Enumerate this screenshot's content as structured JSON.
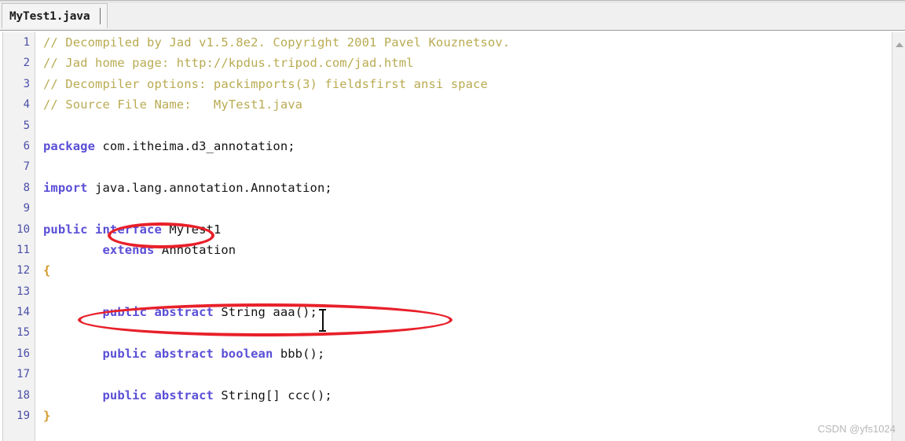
{
  "window": {
    "tab_label": "MyTest1.java"
  },
  "editor": {
    "line_numbers": [
      "1",
      "2",
      "3",
      "4",
      "5",
      "6",
      "7",
      "8",
      "9",
      "10",
      "11",
      "12",
      "13",
      "14",
      "15",
      "16",
      "17",
      "18",
      "19"
    ],
    "lines": [
      {
        "number": "1",
        "tokens": [
          {
            "t": "// Decompiled by Jad v1.5.8e2. Copyright 2001 Pavel Kouznetsov.",
            "c": "comment"
          }
        ]
      },
      {
        "number": "2",
        "tokens": [
          {
            "t": "// Jad home page: http://kpdus.tripod.com/jad.html",
            "c": "comment"
          }
        ]
      },
      {
        "number": "3",
        "tokens": [
          {
            "t": "// Decompiler options: packimports(3) fieldsfirst ansi space",
            "c": "comment"
          }
        ]
      },
      {
        "number": "4",
        "tokens": [
          {
            "t": "// Source File Name:   MyTest1.java",
            "c": "comment"
          }
        ]
      },
      {
        "number": "5",
        "tokens": []
      },
      {
        "number": "6",
        "tokens": [
          {
            "t": "package",
            "c": "keyword"
          },
          {
            "t": " com.itheima.d3_annotation;",
            "c": "plain"
          }
        ]
      },
      {
        "number": "7",
        "tokens": []
      },
      {
        "number": "8",
        "tokens": [
          {
            "t": "import",
            "c": "keyword"
          },
          {
            "t": " java.lang.annotation.Annotation;",
            "c": "plain"
          }
        ]
      },
      {
        "number": "9",
        "tokens": []
      },
      {
        "number": "10",
        "tokens": [
          {
            "t": "public interface",
            "c": "keyword"
          },
          {
            "t": " MyTest1",
            "c": "plain"
          }
        ]
      },
      {
        "number": "11",
        "tokens": [
          {
            "t": "        extends",
            "c": "keyword"
          },
          {
            "t": " Annotation",
            "c": "plain"
          }
        ]
      },
      {
        "number": "12",
        "tokens": [
          {
            "t": "{",
            "c": "brace"
          }
        ]
      },
      {
        "number": "13",
        "tokens": []
      },
      {
        "number": "14",
        "tokens": [
          {
            "t": "        public abstract ",
            "c": "keyword"
          },
          {
            "t": "String aaa();",
            "c": "plain"
          }
        ]
      },
      {
        "number": "15",
        "tokens": []
      },
      {
        "number": "16",
        "tokens": [
          {
            "t": "        public abstract boolean",
            "c": "keyword"
          },
          {
            "t": " bbb();",
            "c": "plain"
          }
        ]
      },
      {
        "number": "17",
        "tokens": []
      },
      {
        "number": "18",
        "tokens": [
          {
            "t": "        public abstract ",
            "c": "keyword"
          },
          {
            "t": "String[] ccc();",
            "c": "plain"
          }
        ]
      },
      {
        "number": "19",
        "tokens": [
          {
            "t": "}",
            "c": "brace"
          }
        ]
      }
    ]
  },
  "annotations": [
    {
      "id": "ellipse-interface",
      "shape": "ellipse",
      "color": "#e8202a",
      "targets": "interface"
    },
    {
      "id": "ellipse-method",
      "shape": "ellipse",
      "color": "#e8202a",
      "targets": "public abstract String aaa();"
    }
  ],
  "scrollbar": {
    "up_arrow": "scroll-up-arrow"
  },
  "watermark": {
    "text": "CSDN @yfs1024"
  }
}
